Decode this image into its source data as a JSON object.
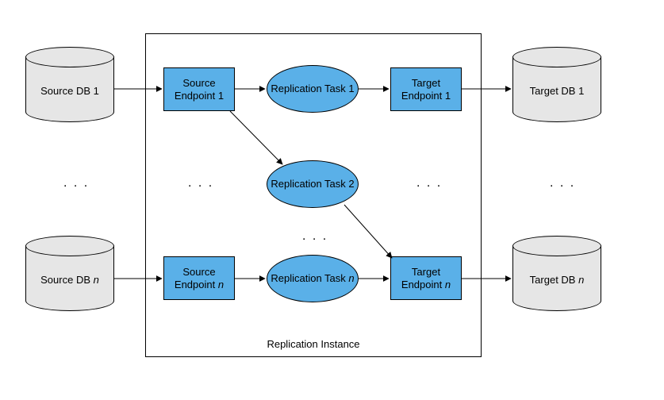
{
  "instance": {
    "label": "Replication Instance"
  },
  "sourceDBs": {
    "first": "Source DB 1",
    "last_prefix": "Source DB ",
    "last_suffix": "n"
  },
  "targetDBs": {
    "first": "Target DB 1",
    "last_prefix": "Target DB ",
    "last_suffix": "n"
  },
  "sourceEndpoints": {
    "first": "Source Endpoint 1",
    "last_prefix": "Source Endpoint ",
    "last_suffix": "n"
  },
  "targetEndpoints": {
    "first": "Target Endpoint 1",
    "last_prefix": "Target Endpoint ",
    "last_suffix": "n"
  },
  "tasks": {
    "t1": "Replication Task 1",
    "t2": "Replication Task 2",
    "tn_prefix": "Replication Task ",
    "tn_suffix": "n"
  },
  "ellipsis": ". . ."
}
